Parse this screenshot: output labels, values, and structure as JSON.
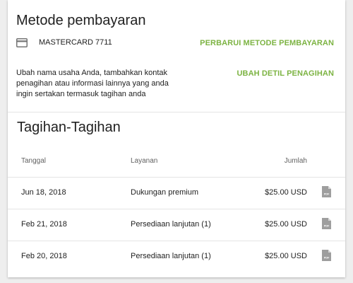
{
  "payment": {
    "title": "Metode pembayaran",
    "card_icon": "credit-card-icon",
    "card_label": "MASTERCARD 7711",
    "update_method_label": "PERBARUI METODE PEMBAYARAN",
    "billing_description": "Ubah nama usaha Anda, tambahkan kontak penagihan atau informasi lainnya yang anda ingin sertakan termasuk tagihan anda",
    "change_billing_label": "UBAH DETIL PENAGIHAN",
    "accent_color": "#7cb342"
  },
  "bills": {
    "title": "Tagihan-Tagihan",
    "columns": {
      "date": "Tanggal",
      "service": "Layanan",
      "amount": "Jumlah"
    },
    "rows": [
      {
        "date": "Jun 18, 2018",
        "service": "Dukungan premium",
        "amount": "$25.00 USD",
        "icon": "pdf-icon"
      },
      {
        "date": "Feb 21, 2018",
        "service": "Persediaan lanjutan (1)",
        "amount": "$25.00 USD",
        "icon": "pdf-icon"
      },
      {
        "date": "Feb 20, 2018",
        "service": "Persediaan lanjutan (1)",
        "amount": "$25.00 USD",
        "icon": "pdf-icon"
      }
    ]
  }
}
